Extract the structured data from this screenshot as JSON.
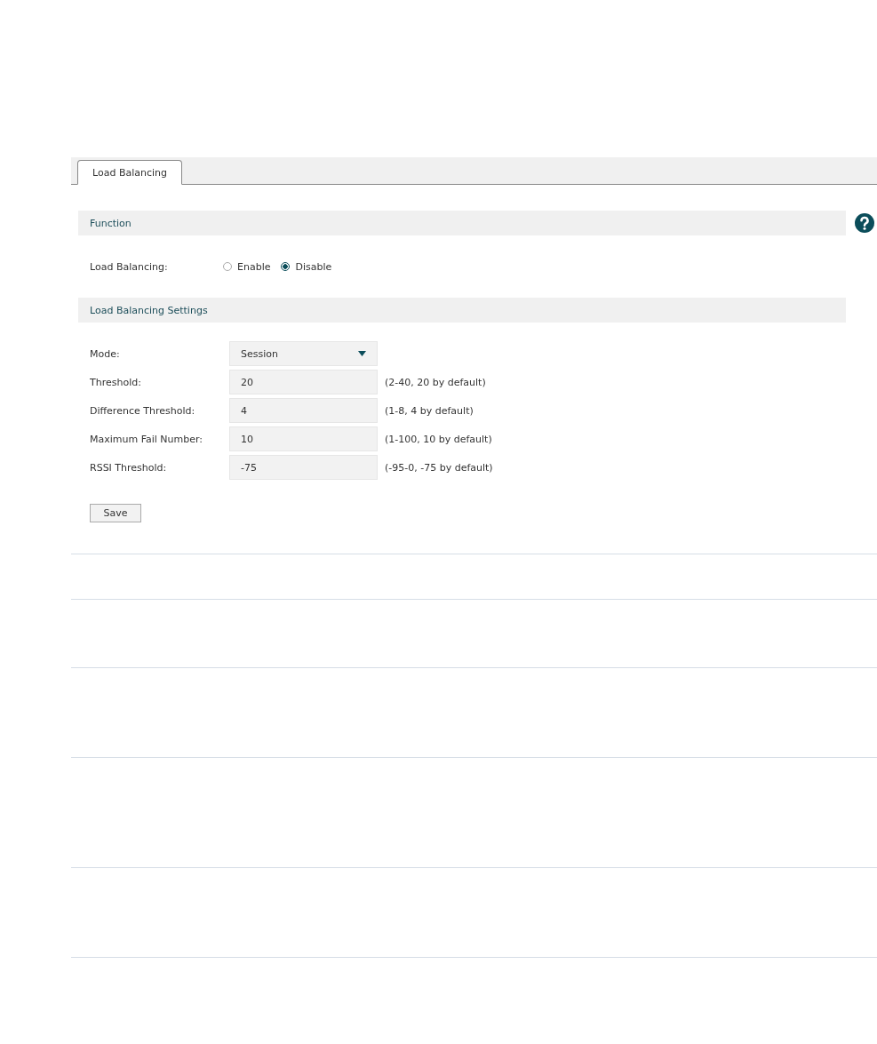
{
  "tabs": [
    {
      "label": "Load Balancing",
      "selected": true
    }
  ],
  "function": {
    "title": "Function",
    "label": "Load Balancing:",
    "options": [
      {
        "label": "Enable",
        "selected": false
      },
      {
        "label": "Disable",
        "selected": true
      }
    ]
  },
  "settings": {
    "title": "Load Balancing Settings",
    "fields": [
      {
        "kind": "select",
        "label": "Mode:",
        "value": "Session"
      },
      {
        "kind": "text",
        "label": "Threshold:",
        "value": "20",
        "hint": "(2-40, 20 by default)"
      },
      {
        "kind": "text",
        "label": "Difference Threshold:",
        "value": "4",
        "hint": "(1-8, 4 by default)"
      },
      {
        "kind": "text",
        "label": "Maximum Fail Number:",
        "value": "10",
        "hint": "(1-100, 10 by default)"
      },
      {
        "kind": "text",
        "label": "RSSI Threshold:",
        "value": "-75",
        "hint": "(-95-0, -75 by default)"
      }
    ]
  },
  "save_button": "Save"
}
